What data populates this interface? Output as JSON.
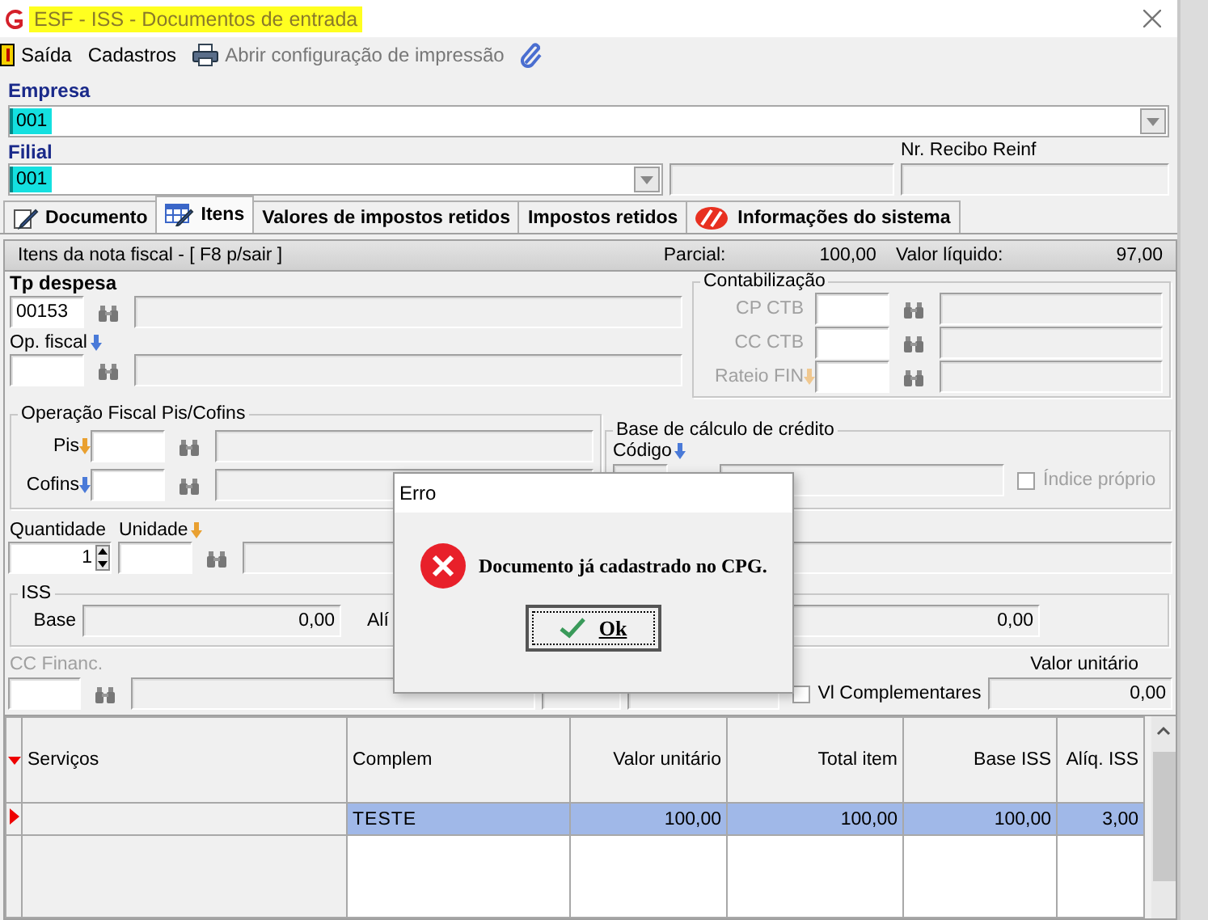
{
  "window": {
    "title": "ESF - ISS - Documentos de entrada"
  },
  "toolbar": [
    {
      "kind": "exit",
      "label": "Saída",
      "disabled": false
    },
    {
      "kind": "plain",
      "label": "Cadastros",
      "disabled": false
    },
    {
      "kind": "print",
      "label": "Abrir configuração de impressão",
      "disabled": true
    },
    {
      "kind": "attach"
    }
  ],
  "empresa": {
    "label": "Empresa",
    "code": "001"
  },
  "filial": {
    "label": "Filial",
    "code": "001"
  },
  "nr_recibo_reinf": {
    "label": "Nr. Recibo Reinf"
  },
  "tabs": [
    {
      "kind": "document",
      "label": "Documento",
      "selected": false
    },
    {
      "kind": "grid",
      "label": "Itens",
      "selected": true
    },
    {
      "kind": "plain",
      "label": "Valores de impostos retidos",
      "selected": false
    },
    {
      "kind": "plain",
      "label": "Impostos retidos",
      "selected": false
    },
    {
      "kind": "info",
      "label": "Informações do sistema",
      "selected": false
    }
  ],
  "panel": {
    "title": "Itens da nota fiscal - [ F8 p/sair ]",
    "parcial_label": "Parcial:",
    "parcial": "100,00",
    "liquido_label": "Valor líquido:",
    "liquido": "97,00"
  },
  "tp_despesa": {
    "label": "Tp despesa",
    "code": "00153"
  },
  "op_fiscal": {
    "label": "Op. fiscal",
    "arrow": true
  },
  "contabilizacao": {
    "title": "Contabilização",
    "rows": [
      {
        "label": "CP CTB",
        "arrow": false,
        "disabled": true
      },
      {
        "label": "CC CTB",
        "arrow": false,
        "disabled": true
      },
      {
        "label": "Rateio FIN",
        "arrow": true,
        "disabled": true
      }
    ]
  },
  "pis_cofins": {
    "title": "Operação Fiscal Pis/Cofins",
    "rows": [
      {
        "label": "Pis",
        "arrow": true
      },
      {
        "label": "Cofins",
        "arrow": true
      }
    ]
  },
  "base_credito": {
    "title": "Base de cálculo de crédito",
    "codigo_label": "Código",
    "indice": {
      "label": "Índice próprio",
      "checked": false,
      "disabled": true
    }
  },
  "quantidade": {
    "label": "Quantidade",
    "value": "1"
  },
  "unidade": {
    "label": "Unidade",
    "arrow": true
  },
  "iss": {
    "title": "ISS",
    "base_label": "Base",
    "base": "0,00",
    "aliq_label": "Alí",
    "aliq_value": "0,00"
  },
  "cc_financ": {
    "label": "CC Financ.",
    "disabled": true
  },
  "vl_complementares": {
    "label": "Vl Complementares",
    "checked": false
  },
  "valor_unitario": {
    "label": "Valor unitário",
    "value": "0,00"
  },
  "table": {
    "columns": [
      "Serviços",
      "Complem",
      "Valor unitário",
      "Total item",
      "Base ISS",
      "Alíq. ISS"
    ],
    "rows": [
      {
        "selected": true,
        "current": true,
        "cells": [
          "",
          "TESTE",
          "100,00",
          "100,00",
          "100,00",
          "3,00"
        ]
      }
    ]
  },
  "dialog": {
    "title": "Erro",
    "message": "Documento já cadastrado no CPG.",
    "button": "Ok"
  }
}
